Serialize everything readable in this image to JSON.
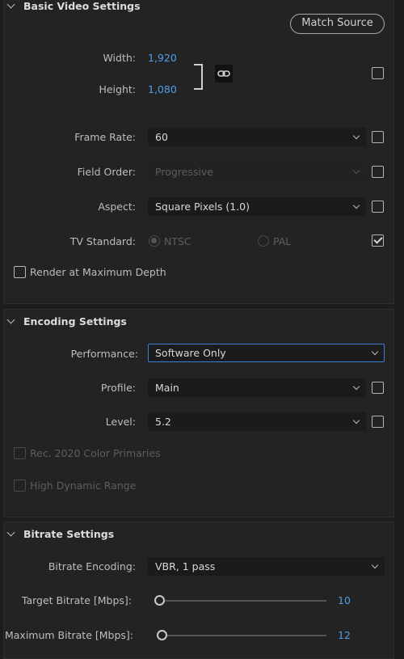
{
  "basic": {
    "title": "Basic Video Settings",
    "match_source": "Match Source",
    "width_label": "Width:",
    "width_value": "1,920",
    "height_label": "Height:",
    "height_value": "1,080",
    "frame_rate_label": "Frame Rate:",
    "frame_rate_value": "60",
    "field_order_label": "Field Order:",
    "field_order_value": "Progressive",
    "aspect_label": "Aspect:",
    "aspect_value": "Square Pixels (1.0)",
    "tv_standard_label": "TV Standard:",
    "tv_ntsc": "NTSC",
    "tv_pal": "PAL",
    "render_max_depth": "Render at Maximum Depth"
  },
  "encoding": {
    "title": "Encoding Settings",
    "performance_label": "Performance:",
    "performance_value": "Software Only",
    "profile_label": "Profile:",
    "profile_value": "Main",
    "level_label": "Level:",
    "level_value": "5.2",
    "rec2020": "Rec. 2020 Color Primaries",
    "hdr": "High Dynamic Range"
  },
  "bitrate": {
    "title": "Bitrate Settings",
    "encoding_label": "Bitrate Encoding:",
    "encoding_value": "VBR, 1 pass",
    "target_label": "Target Bitrate [Mbps]:",
    "target_value": "10",
    "max_label": "Maximum Bitrate [Mbps]:",
    "max_value": "12"
  },
  "colors": {
    "accent": "#4e9fe8",
    "panel": "#232323",
    "focus_border": "#3c7fd6"
  }
}
